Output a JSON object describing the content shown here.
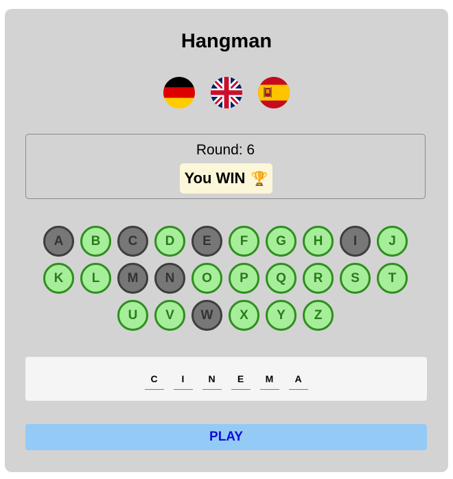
{
  "app": {
    "title": "Hangman"
  },
  "flags": [
    {
      "icon": "germany-flag-icon",
      "name": "German"
    },
    {
      "icon": "uk-flag-icon",
      "name": "English"
    },
    {
      "icon": "spain-flag-icon",
      "name": "Spanish"
    }
  ],
  "status": {
    "round": "Round: 6",
    "result": "You WIN",
    "result_icon": "🏆"
  },
  "letters": [
    {
      "char": "A",
      "state": "used"
    },
    {
      "char": "B",
      "state": "available"
    },
    {
      "char": "C",
      "state": "used"
    },
    {
      "char": "D",
      "state": "available"
    },
    {
      "char": "E",
      "state": "used"
    },
    {
      "char": "F",
      "state": "available"
    },
    {
      "char": "G",
      "state": "available"
    },
    {
      "char": "H",
      "state": "available"
    },
    {
      "char": "I",
      "state": "used"
    },
    {
      "char": "J",
      "state": "available"
    },
    {
      "char": "K",
      "state": "available"
    },
    {
      "char": "L",
      "state": "available"
    },
    {
      "char": "M",
      "state": "used"
    },
    {
      "char": "N",
      "state": "used"
    },
    {
      "char": "O",
      "state": "available"
    },
    {
      "char": "P",
      "state": "available"
    },
    {
      "char": "Q",
      "state": "available"
    },
    {
      "char": "R",
      "state": "available"
    },
    {
      "char": "S",
      "state": "available"
    },
    {
      "char": "T",
      "state": "available"
    },
    {
      "char": "U",
      "state": "available"
    },
    {
      "char": "V",
      "state": "available"
    },
    {
      "char": "W",
      "state": "used"
    },
    {
      "char": "X",
      "state": "available"
    },
    {
      "char": "Y",
      "state": "available"
    },
    {
      "char": "Z",
      "state": "available"
    }
  ],
  "word": [
    "C",
    "I",
    "N",
    "E",
    "M",
    "A"
  ],
  "play_button": {
    "label": "PLAY"
  },
  "colors": {
    "card_bg": "#d3d3d3",
    "letter_available_bg": "#a6ee9a",
    "letter_available_border": "#2f8f1f",
    "letter_used_bg": "#777777",
    "result_bg": "#fbf7d8",
    "play_bg": "#94caf6",
    "play_text": "#0d0dd9"
  }
}
